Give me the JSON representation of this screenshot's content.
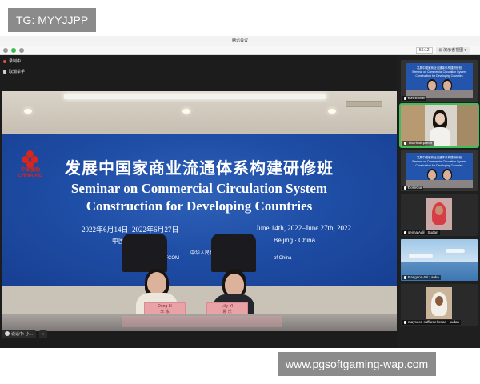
{
  "watermark_top": "TG: MYYJJPP",
  "watermark_bottom": "www.pgsoftgaming-wap.com",
  "window": {
    "title": "腾讯会议",
    "timer": "56:12",
    "view_button": "⊞ 演示者视图 ▾",
    "more": "···"
  },
  "meeting": {
    "recording_label": "录制中",
    "cancel_raise_label": "取消举手",
    "bottom_speaking": "说话中: 小...",
    "collapse": "‹"
  },
  "banner": {
    "logo_text": "CHINA AID",
    "logo_text_zh": "中国援助",
    "title_zh": "发展中国家商业流通体系构建研修班",
    "title_en_line1": "Seminar on Commercial Circulation System",
    "title_en_line2": "Construction for Developing Countries",
    "date_left": "2022年6月14日–2022年6月27日",
    "date_right": "June 14th, 2022–June 27th, 2022",
    "place_left": "中国",
    "place_right": "Beijing · China",
    "sponsor_left": "Sponsored by MOFCOM",
    "sponsor_middle": "中华人民共和国商务部",
    "sponsor_right": "of China"
  },
  "speakers": [
    {
      "nameplate_en": "Dong LI",
      "nameplate_zh": "李 栋"
    },
    {
      "nameplate_en": "Lilly YI",
      "nameplate_zh": "易 乐"
    }
  ],
  "participants": [
    {
      "name": "EJCCCSE",
      "active": false
    },
    {
      "name": "Tina-interpreter",
      "active": true
    },
    {
      "name": "DonliCui",
      "active": false
    },
    {
      "name": "seima Adil - Sudan",
      "active": false
    },
    {
      "name": "Rangana-Sri Lanka",
      "active": false
    },
    {
      "name": "maysoon saffaraelcreas - sudan",
      "active": false
    }
  ],
  "colors": {
    "banner_blue": "#1f4ea6",
    "logo_red": "#d9261c",
    "active_green": "#3fbf5a"
  }
}
